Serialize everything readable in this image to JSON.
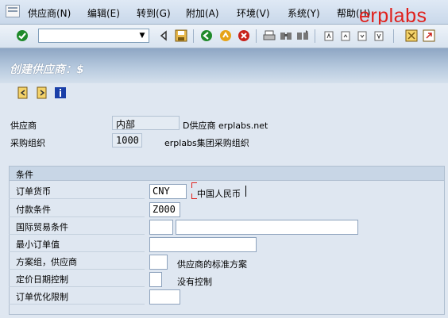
{
  "menu": {
    "items": [
      "供应商(N)",
      "编辑(E)",
      "转到(G)",
      "附加(A)",
      "环境(V)",
      "系统(Y)",
      "帮助(H)"
    ]
  },
  "brand": "erplabs",
  "command_field": {
    "value": ""
  },
  "page": {
    "title": "创建供应商：$"
  },
  "vendor": {
    "label": "供应商",
    "value": "内部",
    "description": "D供应商 erplabs.net"
  },
  "purch_org": {
    "label": "采购组织",
    "value": "1000",
    "description": "erplabs集团采购组织"
  },
  "conditions": {
    "title": "条件",
    "rows": [
      {
        "label": "订单货币",
        "value": "CNY",
        "extra": "中国人民币"
      },
      {
        "label": "付款条件",
        "value": "Z000",
        "extra": ""
      },
      {
        "label": "国际贸易条件",
        "value": "",
        "extra": ""
      },
      {
        "label": "最小订单值",
        "value": "",
        "extra": ""
      },
      {
        "label": "方案组，供应商",
        "value": "",
        "extra": "供应商的标准方案"
      },
      {
        "label": "定价日期控制",
        "value": "",
        "extra": "没有控制"
      },
      {
        "label": "订单优化限制",
        "value": "",
        "extra": ""
      }
    ]
  },
  "colors": {
    "brand": "#e0201c",
    "title_bg": "#8ea6c4",
    "page_bg": "#dfe7f1"
  }
}
